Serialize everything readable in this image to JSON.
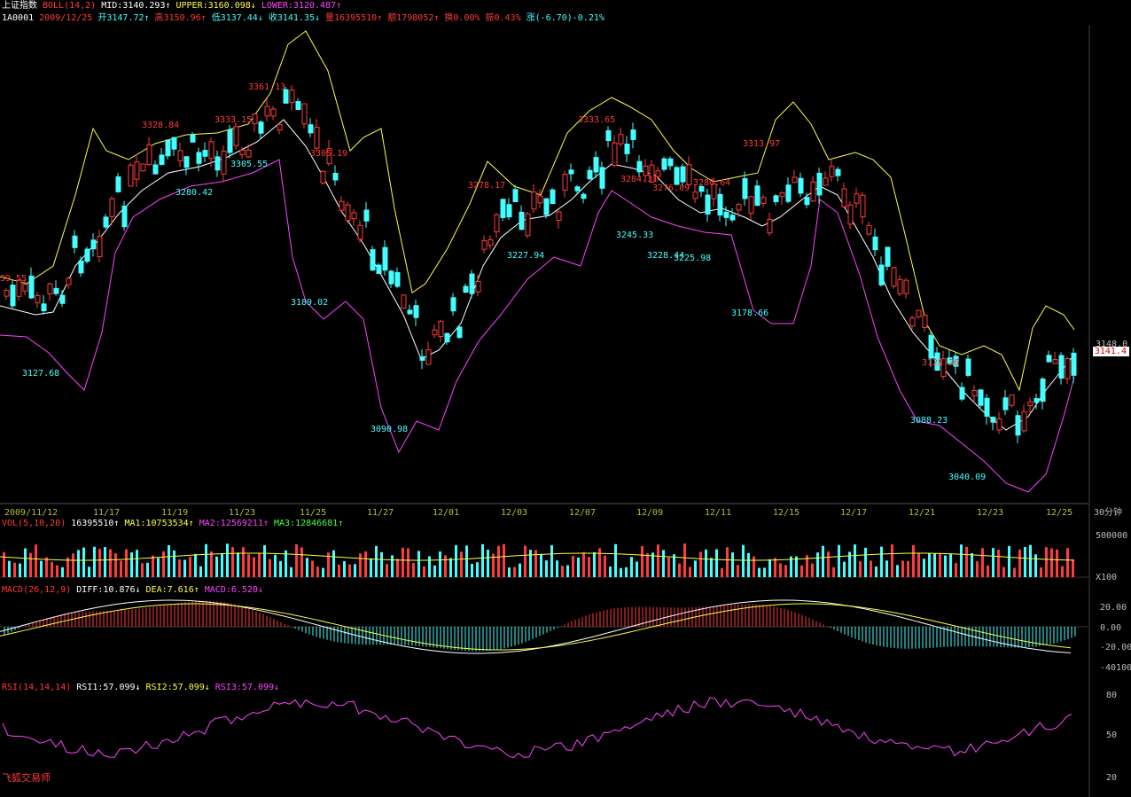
{
  "header": {
    "index_name": "上证指数",
    "boll_label": "BOLL(14,2)",
    "mid": "MID:3140.293↑",
    "upper": "UPPER:3160.098↓",
    "lower": "LOWER:3120.487↑"
  },
  "quote": {
    "code": "1A0001",
    "date": "2009/12/25",
    "open": "开3147.72↑",
    "high": "高3150.96↑",
    "low": "低3137.44↓",
    "close": "收3141.35↓",
    "volume": "量16395510↑",
    "amount": "额1798052↑",
    "turnover": "换0.00%",
    "amplitude": "振0.43%",
    "change": "涨(-6.70)-0.21%"
  },
  "price_axis": {
    "ref_label": "3148.0",
    "current_tag": "3141.4"
  },
  "annotations_red": [
    "39.55",
    "3328.84",
    "3333.15",
    "3361.13",
    "3305.19",
    "3278.17",
    "3333.65",
    "3284.31",
    "3276.09",
    "3280.64",
    "3313.97",
    "3128.36"
  ],
  "annotations_cyan": [
    "3127.68",
    "3280.42",
    "3305.55",
    "3189.02",
    "3090.98",
    "3227.94",
    "3245.33",
    "3228.44",
    "3225.98",
    "3178.66",
    "3088.23",
    "3040.09"
  ],
  "time_axis": [
    "2009/11/12",
    "11/17",
    "11/19",
    "11/23",
    "11/25",
    "11/27",
    "12/01",
    "12/03",
    "12/07",
    "12/09",
    "12/11",
    "12/15",
    "12/17",
    "12/21",
    "12/23",
    "12/25"
  ],
  "period_label": "30分钟",
  "volume_panel": {
    "label": "VOL(5,10,20)",
    "value": "16395510↑",
    "ma1": "MA1:10753534↑",
    "ma2": "MA2:12569211↑",
    "ma3": "MA3:12846681↑",
    "axis_top": "500000",
    "axis_unit": "X100"
  },
  "macd_panel": {
    "label": "MACD(26,12,9)",
    "diff": "DIFF:10.876↓",
    "dea": "DEA:7.616↑",
    "macd": "MACD:6.520↓",
    "axis": [
      "20.00",
      "0.00",
      "-20.00",
      "-40100"
    ]
  },
  "rsi_panel": {
    "label": "RSI(14,14,14)",
    "rsi1": "RSI1:57.099↓",
    "rsi2": "RSI2:57.099↓",
    "rsi3": "RSI3:57.099↓",
    "axis": [
      "80",
      "50",
      "20"
    ]
  },
  "brand": "飞狐交易师",
  "colors": {
    "up": "#ff3b3b",
    "down": "#44ffff",
    "mid": "#ffffff",
    "upper": "#ffff44",
    "lower": "#ff44ff"
  }
}
